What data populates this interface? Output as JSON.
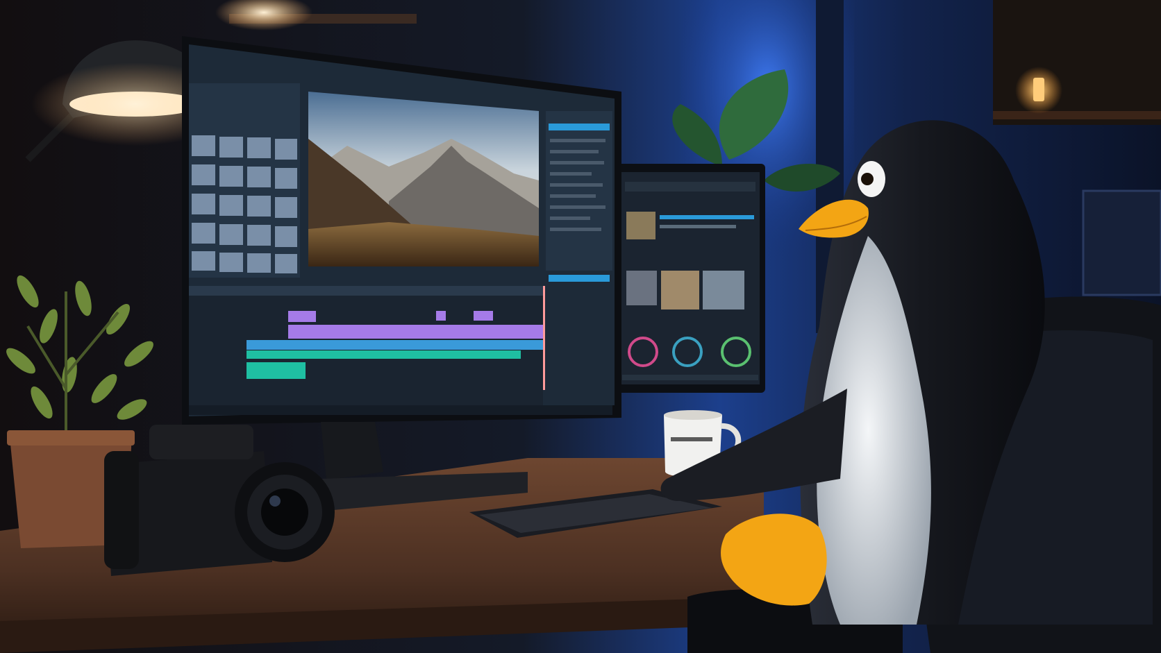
{
  "scene": {
    "palette": {
      "room_dark": "#0b0e16",
      "wall_blue": "#1c3f8c",
      "window_glow": "#2f66d8",
      "lamp_glow": "#ffd7a0",
      "desk_wood": "#5a3a26",
      "desk_edge": "#3a2418",
      "screen_bg": "#1d2a38",
      "panel_bg": "#243445",
      "timeline_purple": "#a57be8",
      "timeline_teal": "#1fbfa2",
      "timeline_blue": "#3a9ad9",
      "penguin_black": "#14161c",
      "penguin_white": "#e9ecef",
      "penguin_beak": "#f3a514",
      "plant_green": "#6e8a3a",
      "pot_clay": "#7a4a32",
      "mug_white": "#f1f1ef",
      "chair_black": "#111318"
    }
  }
}
